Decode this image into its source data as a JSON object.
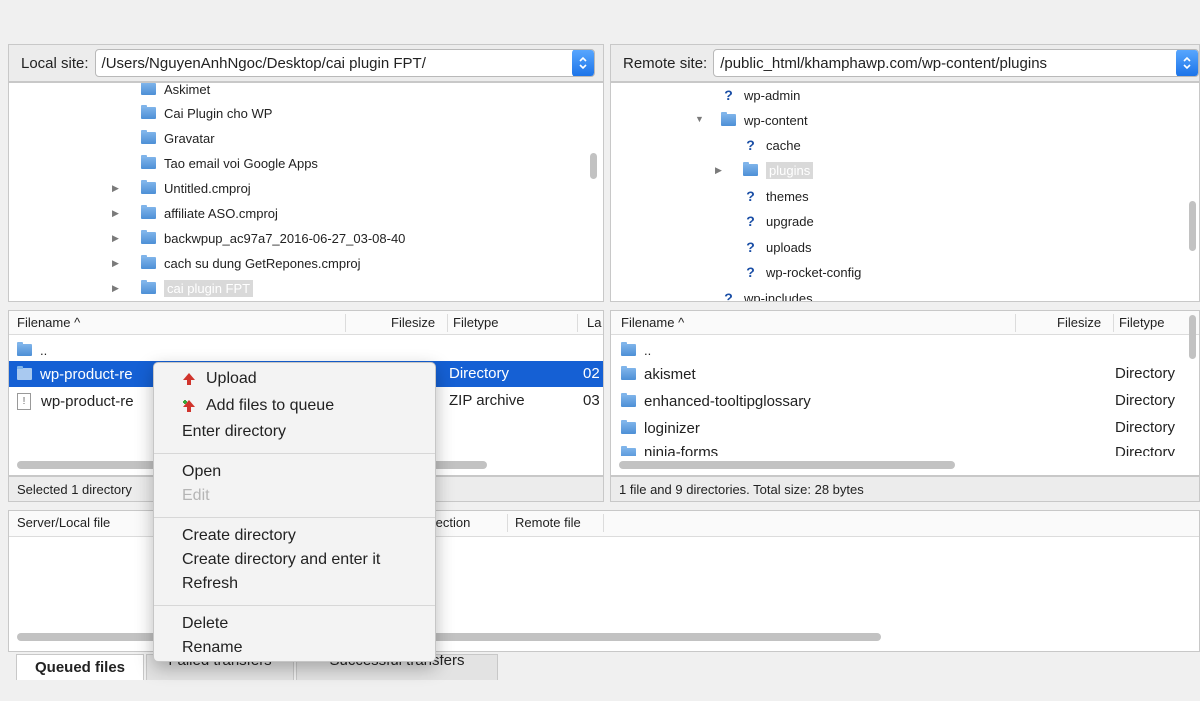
{
  "local_site": {
    "label": "Local site:",
    "path": "/Users/NguyenAnhNgoc/Desktop/cai plugin FPT/"
  },
  "remote_site": {
    "label": "Remote site:",
    "path": "/public_html/khamphawp.com/wp-content/plugins"
  },
  "local_tree": {
    "items": [
      {
        "label": "Askimet"
      },
      {
        "label": "Cai Plugin cho WP"
      },
      {
        "label": "Gravatar"
      },
      {
        "label": "Tao email voi Google Apps"
      },
      {
        "label": "Untitled.cmproj"
      },
      {
        "label": "affiliate ASO.cmproj"
      },
      {
        "label": "backwpup_ac97a7_2016-06-27_03-08-40"
      },
      {
        "label": "cach su dung GetRepones.cmproj"
      },
      {
        "label": "cai plugin FPT"
      }
    ]
  },
  "remote_tree": {
    "items": [
      {
        "label": "wp-admin"
      },
      {
        "label": "wp-content"
      },
      {
        "label": "cache"
      },
      {
        "label": "plugins"
      },
      {
        "label": "themes"
      },
      {
        "label": "upgrade"
      },
      {
        "label": "uploads"
      },
      {
        "label": "wp-rocket-config"
      },
      {
        "label": "wp-includes"
      }
    ]
  },
  "local_list": {
    "columns": {
      "filename": "Filename ^",
      "filesize": "Filesize",
      "filetype": "Filetype",
      "last": "La"
    },
    "rows": [
      {
        "name": "..",
        "type": "",
        "date": ""
      },
      {
        "name": "wp-product-re",
        "type": "Directory",
        "date": "02"
      },
      {
        "name": "wp-product-re",
        "type": "ZIP archive",
        "date": "03"
      }
    ],
    "status": "Selected 1 directory"
  },
  "remote_list": {
    "columns": {
      "filename": "Filename ^",
      "filesize": "Filesize",
      "filetype": "Filetype"
    },
    "rows": [
      {
        "name": "..",
        "type": ""
      },
      {
        "name": "akismet",
        "type": "Directory"
      },
      {
        "name": "enhanced-tooltipglossary",
        "type": "Directory"
      },
      {
        "name": "loginizer",
        "type": "Directory"
      },
      {
        "name": "ninja-forms",
        "type": "Directory"
      }
    ],
    "status": "1 file and 9 directories. Total size: 28 bytes"
  },
  "queue": {
    "columns": {
      "server_local": "Server/Local file",
      "direction": "Direction",
      "remote": "Remote file"
    }
  },
  "context_menu": {
    "upload": "Upload",
    "add_to_queue": "Add files to queue",
    "enter_directory": "Enter directory",
    "open": "Open",
    "edit": "Edit",
    "create_directory": "Create directory",
    "create_directory_enter": "Create directory and enter it",
    "refresh": "Refresh",
    "delete": "Delete",
    "rename": "Rename"
  },
  "tabs": {
    "queued": "Queued files",
    "failed": "Failed transfers",
    "successful": "Successful transfers"
  },
  "colors": {
    "selection": "#1560d4",
    "accent": "#1a72e8",
    "upload_arrow": "#d0342c",
    "queue_arrow": "#3aa63a"
  }
}
